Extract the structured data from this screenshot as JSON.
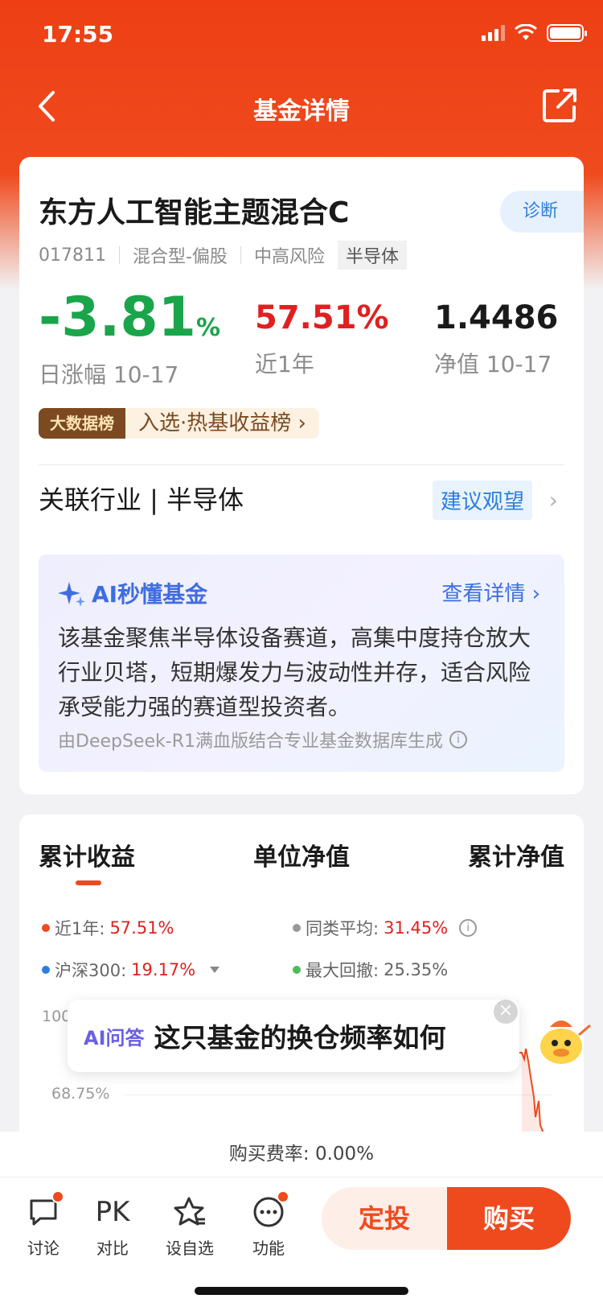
{
  "status": {
    "time": "17:55"
  },
  "nav": {
    "title": "基金详情"
  },
  "fund": {
    "name": "东方人工智能主题混合C",
    "diagnose": "诊断",
    "code": "017811",
    "type": "混合型-偏股",
    "risk": "中高风险",
    "theme_tag": "半导体"
  },
  "metrics": {
    "daily_change": "-3.81",
    "daily_change_unit": "%",
    "daily_change_label": "日涨幅 10-17",
    "year_return": "57.51%",
    "year_return_label": "近1年",
    "nav": "1.4486",
    "nav_label": "净值 10-17"
  },
  "rank": {
    "badge": "大数据榜",
    "text": "入选·热基收益榜 ›"
  },
  "industry": {
    "label": "关联行业 | 半导体",
    "advice": "建议观望",
    "arrow": "›"
  },
  "ai": {
    "title": "AI秒懂基金",
    "more": "查看详情 ›",
    "body": "该基金聚焦半导体设备赛道，高集中度持仓放大行业贝塔，短期爆发力与波动性并存，适合风险承受能力强的赛道型投资者。",
    "footnote": "由DeepSeek-R1满血版结合专业基金数据库生成"
  },
  "chart_tabs": [
    "累计收益",
    "单位净值",
    "累计净值"
  ],
  "legend": {
    "year_label": "近1年:",
    "year_value": "57.51%",
    "peer_label": "同类平均:",
    "peer_value": "31.45%",
    "hs300_label": "沪深300:",
    "hs300_value": "19.17%",
    "drawdown_label": "最大回撤:",
    "drawdown_value": "25.35%"
  },
  "chart_data": {
    "type": "line",
    "ytick_labels": [
      "100",
      "68.75%"
    ],
    "series": []
  },
  "ai_ask": {
    "tag": "AI问答",
    "question": "这只基金的换仓频率如何",
    "close": "×"
  },
  "fee": "购买费率: 0.00%",
  "bottom": {
    "discuss": "讨论",
    "pk_icon": "PK",
    "compare": "对比",
    "watchlist": "设自选",
    "functions": "功能",
    "sip": "定投",
    "buy": "购买"
  },
  "colors": {
    "brand": "#ef4a1e",
    "down": "#1aa54a",
    "up": "#e02020",
    "accent_blue": "#2b7fdf"
  }
}
